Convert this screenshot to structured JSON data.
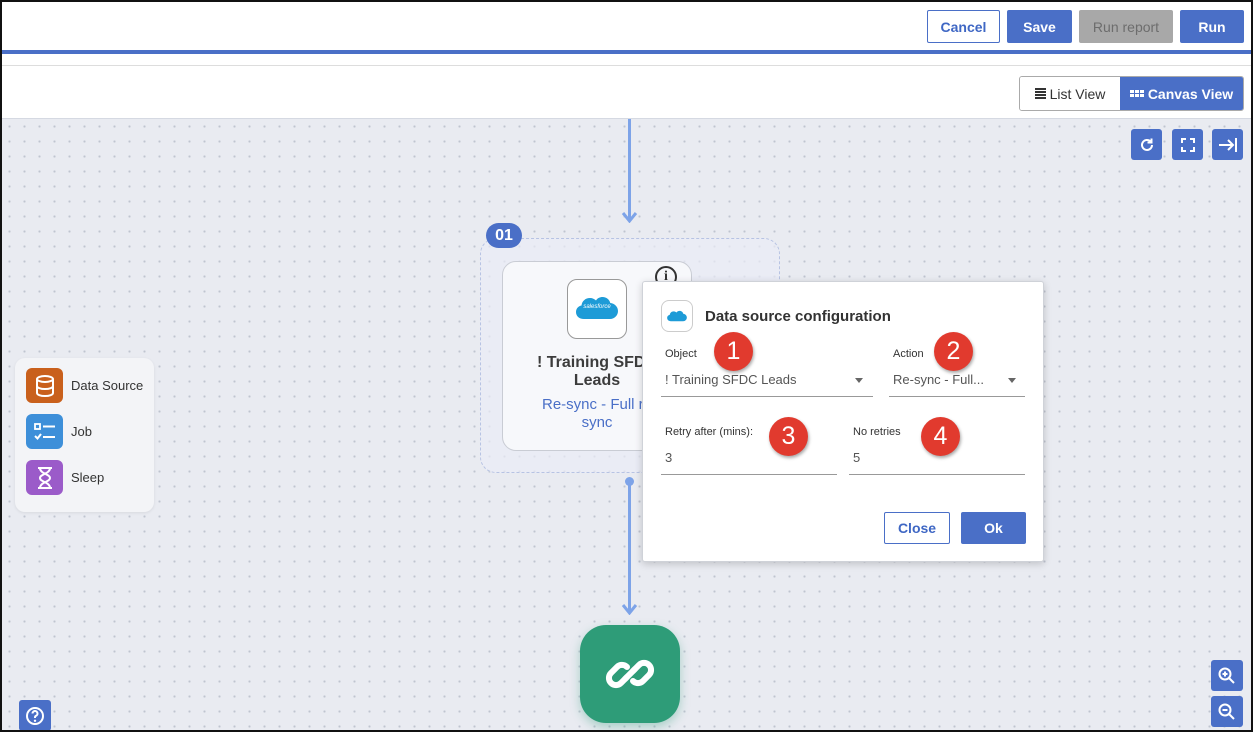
{
  "toolbar": {
    "cancel_label": "Cancel",
    "save_label": "Save",
    "run_report_label": "Run report",
    "run_label": "Run"
  },
  "view_toggle": {
    "list_label": "List View",
    "canvas_label": "Canvas View",
    "selected": "Canvas View"
  },
  "canvas_tools": [
    "refresh-icon",
    "fullscreen-icon",
    "collapse-panel-icon"
  ],
  "node": {
    "badge": "01",
    "title_line1": "! Training SFDC",
    "title_line2": "Leads",
    "subtitle_line1": "Re-sync - Full re",
    "subtitle_line2": "sync",
    "logo_text": "salesforce"
  },
  "palette": {
    "items": [
      {
        "label": "Data Source",
        "icon": "database-icon",
        "color": "#c9601c"
      },
      {
        "label": "Job",
        "icon": "checklist-icon",
        "color": "#3d8fd9"
      },
      {
        "label": "Sleep",
        "icon": "hourglass-icon",
        "color": "#9b5bc9"
      }
    ]
  },
  "dialog": {
    "title": "Data source configuration",
    "logo_text": "salesforce",
    "object": {
      "label": "Object",
      "value": "! Training SFDC Leads"
    },
    "action": {
      "label": "Action",
      "value": "Re-sync - Full..."
    },
    "retry": {
      "label": "Retry after (mins):",
      "value": "3"
    },
    "no_retries": {
      "label": "No retries",
      "value": "5"
    },
    "close_label": "Close",
    "ok_label": "Ok",
    "callouts": [
      "1",
      "2",
      "3",
      "4"
    ]
  },
  "colors": {
    "accent": "#4a6fc7",
    "link_node": "#2e9c78",
    "callout": "#e13a2e"
  }
}
